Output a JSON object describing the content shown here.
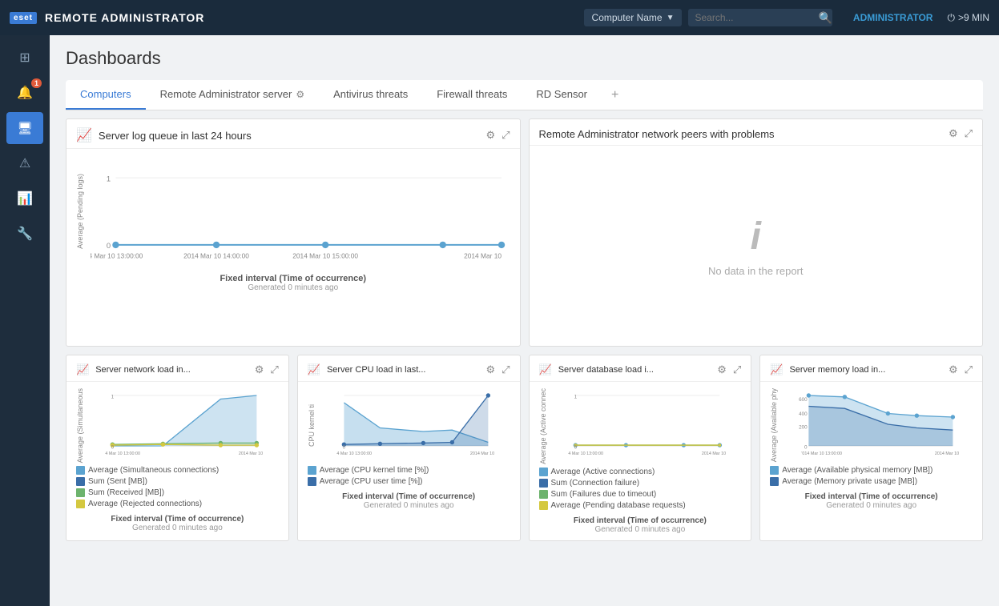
{
  "app": {
    "logo": "eset",
    "title": "REMOTE ADMINISTRATOR"
  },
  "nav": {
    "computer_name": "Computer Name",
    "search_placeholder": "Search...",
    "admin": "ADMINISTRATOR",
    "logout": ">9 MIN"
  },
  "sidebar": {
    "items": [
      {
        "id": "dashboard",
        "icon": "⊞",
        "active": true
      },
      {
        "id": "notifications",
        "icon": "🔔",
        "badge": "1"
      },
      {
        "id": "computers",
        "icon": "💻"
      },
      {
        "id": "alerts",
        "icon": "⚠"
      },
      {
        "id": "reports",
        "icon": "📊"
      },
      {
        "id": "tools",
        "icon": "🔧"
      }
    ]
  },
  "page": {
    "title": "Dashboards"
  },
  "tabs": [
    {
      "id": "computers",
      "label": "Computers",
      "active": true
    },
    {
      "id": "remote-admin",
      "label": "Remote Administrator server",
      "gear": true
    },
    {
      "id": "antivirus",
      "label": "Antivirus threats"
    },
    {
      "id": "firewall",
      "label": "Firewall threats"
    },
    {
      "id": "rd-sensor",
      "label": "RD Sensor"
    },
    {
      "id": "add",
      "label": "+"
    }
  ],
  "charts": {
    "top_left": {
      "title": "Server log queue in last 24 hours",
      "y_label": "Average (Pending logs)",
      "times": [
        "4 Mar 10 13:00:00",
        "2014 Mar 10 14:00:00",
        "2014 Mar 10 15:00:00",
        "2014 Mar 10"
      ],
      "footer_label": "Fixed interval (Time of occurrence)",
      "generated": "Generated 0 minutes ago",
      "zero_label": "0"
    },
    "top_right": {
      "title": "Remote Administrator network peers with problems",
      "no_data": "No data in the report"
    },
    "bottom_left": {
      "title": "Server network load in...",
      "y_label": "Average (Simultaneous",
      "legend": [
        {
          "color": "#5ba3d0",
          "label": "Average (Simultaneous connections)"
        },
        {
          "color": "#3a6ea8",
          "label": "Sum (Sent [MB])"
        },
        {
          "color": "#6db36d",
          "label": "Sum (Received [MB])"
        },
        {
          "color": "#d4c840",
          "label": "Average (Rejected connections)"
        }
      ],
      "times": [
        "4 Mar 10 13:00:00",
        "2014 Mar 10"
      ],
      "footer_label": "Fixed interval (Time of occurrence)",
      "generated": "Generated 0 minutes ago"
    },
    "bottom_cpu": {
      "title": "Server CPU load in last...",
      "y_label": "CPU kernel ti",
      "legend": [
        {
          "color": "#5ba3d0",
          "label": "Average (CPU kernel time [%])"
        },
        {
          "color": "#3a6ea8",
          "label": "Average (CPU user time [%])"
        }
      ],
      "times": [
        "4 Mar 10 13:00:00",
        "2014 Mar 10"
      ],
      "footer_label": "Fixed interval (Time of occurrence)",
      "generated": "Generated 0 minutes ago"
    },
    "bottom_db": {
      "title": "Server database load i...",
      "y_label": "Average (Active connec",
      "legend": [
        {
          "color": "#5ba3d0",
          "label": "Average (Active connections)"
        },
        {
          "color": "#3a6ea8",
          "label": "Sum (Connection failure)"
        },
        {
          "color": "#6db36d",
          "label": "Sum (Failures due to timeout)"
        },
        {
          "color": "#d4c840",
          "label": "Average (Pending database requests)"
        }
      ],
      "times": [
        "4 Mar 10 13:00:00",
        "2014 Mar 10"
      ],
      "footer_label": "Fixed interval (Time of occurrence)",
      "generated": "Generated 0 minutes ago"
    },
    "bottom_mem": {
      "title": "Server memory load in...",
      "y_label": "Average (Available phy",
      "legend": [
        {
          "color": "#5ba3d0",
          "label": "Average (Available physical memory [MB])"
        },
        {
          "color": "#3a6ea8",
          "label": "Average (Memory private usage [MB])"
        }
      ],
      "y_vals": [
        "600",
        "400",
        "200",
        "0"
      ],
      "times": [
        "'014 Mar 10 13:00:00",
        "2014 Mar 10"
      ],
      "footer_label": "Fixed interval (Time of occurrence)",
      "generated": "Generated 0 minutes ago"
    }
  }
}
